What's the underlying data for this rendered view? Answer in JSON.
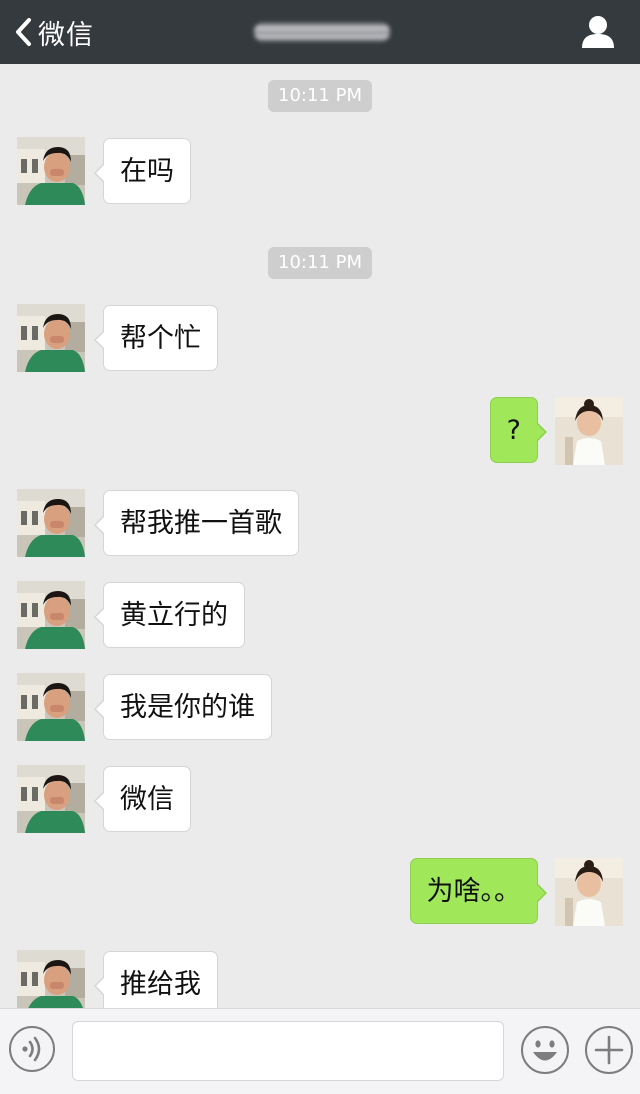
{
  "header": {
    "back_label": "微信",
    "chat_title": "",
    "back_icon": "chevron-left-icon",
    "profile_icon": "person-icon"
  },
  "messages": [
    {
      "type": "time",
      "text": "10:11 PM"
    },
    {
      "type": "in",
      "text": "在吗"
    },
    {
      "type": "time",
      "text": "10:11 PM"
    },
    {
      "type": "in",
      "text": "帮个忙"
    },
    {
      "type": "out",
      "text": "?"
    },
    {
      "type": "in",
      "text": "帮我推一首歌"
    },
    {
      "type": "in",
      "text": "黄立行的"
    },
    {
      "type": "in",
      "text": "我是你的谁"
    },
    {
      "type": "in",
      "text": "微信"
    },
    {
      "type": "out",
      "text": "为啥。。"
    },
    {
      "type": "in",
      "text": "推给我"
    }
  ],
  "input_bar": {
    "value": "",
    "voice_icon": "voice-icon",
    "emoji_icon": "emoji-icon",
    "plus_icon": "plus-icon"
  },
  "colors": {
    "nav_bg": "#353a3f",
    "chat_bg": "#ebebeb",
    "incoming_bubble": "#ffffff",
    "outgoing_bubble": "#a0e75a",
    "timestamp_bg": "#cececf"
  }
}
